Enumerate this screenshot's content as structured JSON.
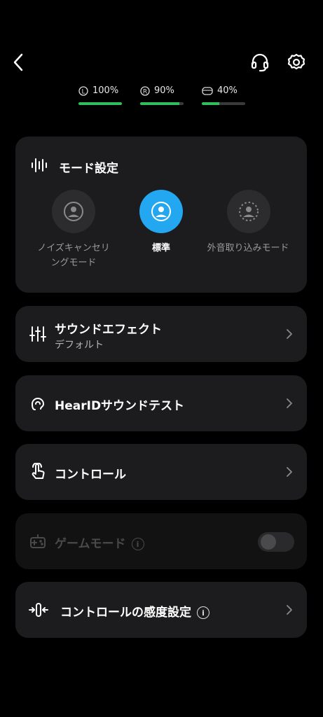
{
  "header": {
    "back_icon": "chevron-left-icon",
    "headset_icon": "headset-icon",
    "settings_icon": "gear-icon"
  },
  "battery": [
    {
      "label": "L",
      "value": "100%",
      "level": 1.0
    },
    {
      "label": "R",
      "value": "90%",
      "level": 0.9
    },
    {
      "label": "case",
      "value": "40%",
      "level": 0.4
    }
  ],
  "mode_card": {
    "title": "モード設定",
    "modes": [
      {
        "label_line1": "ノイズキャンセリ",
        "label_line2": "ングモード",
        "active": false
      },
      {
        "label_line1": "標準",
        "label_line2": "",
        "active": true
      },
      {
        "label_line1": "外音取り込みモード",
        "label_line2": "",
        "active": false
      }
    ]
  },
  "sound_effect": {
    "title": "サウンドエフェクト",
    "subtitle": "デフォルト"
  },
  "hearid": {
    "title": "HearIDサウンドテスト"
  },
  "control": {
    "title": "コントロール"
  },
  "game_mode": {
    "title": "ゲームモード",
    "enabled": false
  },
  "sensitivity": {
    "title": "コントロールの感度設定"
  },
  "colors": {
    "accent": "#22a7f0",
    "battery": "#2fbe5b",
    "card": "#1c1c1e"
  }
}
